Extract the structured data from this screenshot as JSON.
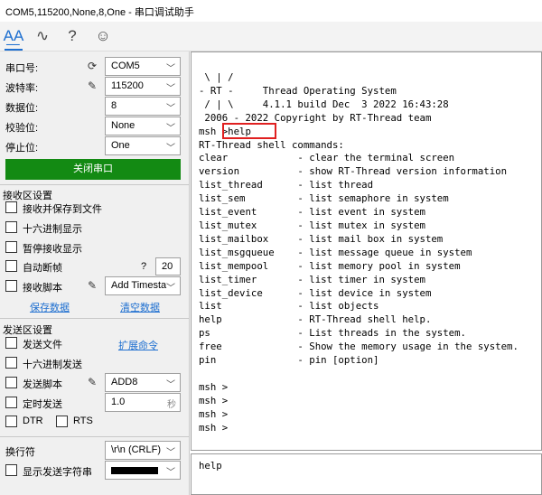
{
  "window": {
    "title": "COM5,115200,None,8,One - 串口调试助手"
  },
  "toolbar": {
    "icons": [
      "text-icon",
      "chart-icon",
      "help-icon",
      "emoji-icon"
    ],
    "glyphs": [
      "A͟A",
      "∿",
      "?",
      "☺"
    ]
  },
  "serial": {
    "port": {
      "label": "串口号:",
      "value": "COM5"
    },
    "baud": {
      "label": "波特率:",
      "value": "115200"
    },
    "databits": {
      "label": "数据位:",
      "value": "8"
    },
    "parity": {
      "label": "校验位:",
      "value": "None"
    },
    "stopbits": {
      "label": "停止位:",
      "value": "One"
    },
    "open_button": "关闭串口"
  },
  "receive": {
    "title": "接收区设置",
    "options": [
      "接收并保存到文件",
      "十六进制显示",
      "暂停接收显示"
    ],
    "autobreak": {
      "label": "自动断帧",
      "help": "?",
      "value": "20"
    },
    "script": {
      "label": "接收脚本",
      "value": "Add Timesta"
    },
    "save": "保存数据",
    "clear": "清空数据"
  },
  "send": {
    "title": "发送区设置",
    "send_file": "发送文件",
    "extend_cmd": "扩展命令",
    "hex_send": "十六进制发送",
    "script": {
      "label": "发送脚本",
      "value": "ADD8"
    },
    "timed": {
      "label": "定时发送",
      "value": "1.0",
      "unit": "秒"
    },
    "dtr": "DTR",
    "rts": "RTS",
    "newline": {
      "label": "换行符",
      "value": "\\r\\n (CRLF)"
    },
    "show_send": {
      "label": "显示发送字符串",
      "color": "#000000"
    }
  },
  "terminal": {
    "lines": [
      " \\ | /",
      "- RT -     Thread Operating System",
      " / | \\     4.1.1 build Dec  3 2022 16:43:28",
      " 2006 - 2022 Copyright by RT-Thread team",
      "msh >help",
      "RT-Thread shell commands:",
      "clear            - clear the terminal screen",
      "version          - show RT-Thread version information",
      "list_thread      - list thread",
      "list_sem         - list semaphore in system",
      "list_event       - list event in system",
      "list_mutex       - list mutex in system",
      "list_mailbox     - list mail box in system",
      "list_msgqueue    - list message queue in system",
      "list_mempool     - list memory pool in system",
      "list_timer       - list timer in system",
      "list_device      - list device in system",
      "list             - list objects",
      "help             - RT-Thread shell help.",
      "ps               - List threads in the system.",
      "free             - Show the memory usage in the system.",
      "pin              - pin [option]",
      "",
      "msh >",
      "msh >",
      "msh >",
      "msh >"
    ],
    "input": "help"
  }
}
